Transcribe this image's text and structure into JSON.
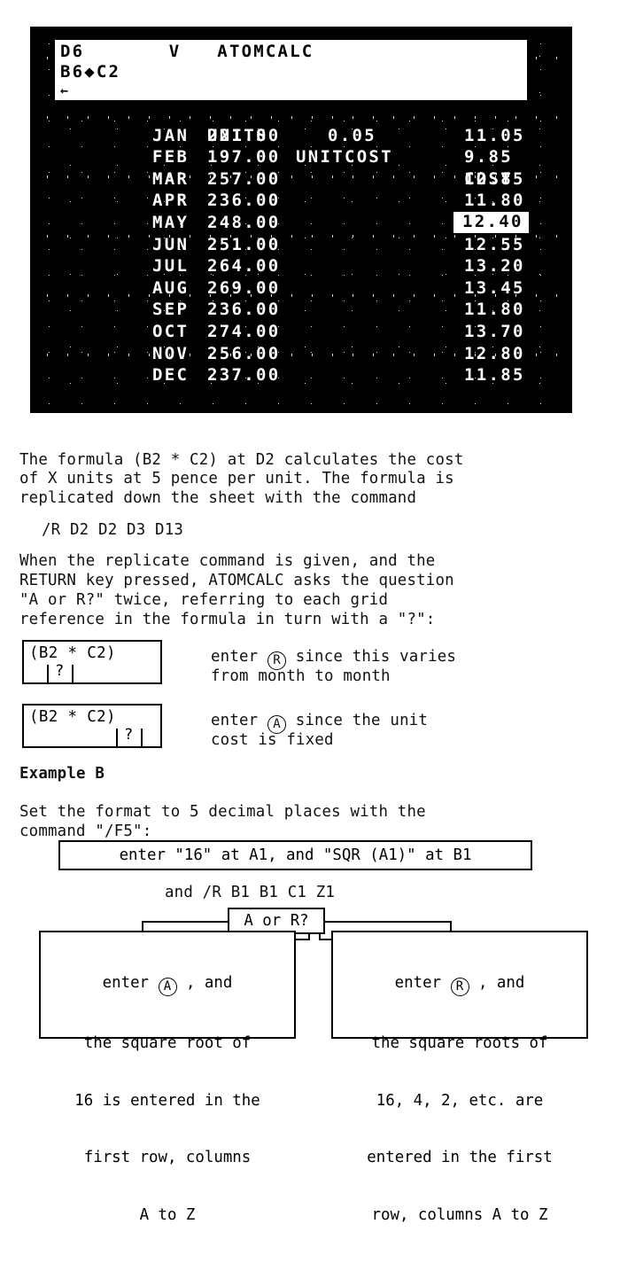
{
  "screen": {
    "status_line1": "D6       V   ATOMCALC",
    "status_line2": "B6◆C2",
    "status_line3": "←",
    "header": {
      "label": "",
      "units": "UNITS",
      "unitcost": "UNITCOST",
      "cost": "COST"
    },
    "rows": [
      {
        "label": "JAN",
        "units": "221.00",
        "unitcost": "0.05",
        "cost": "11.05",
        "highlight": false
      },
      {
        "label": "FEB",
        "units": "197.00",
        "unitcost": "",
        "cost": "9.85",
        "highlight": false
      },
      {
        "label": "MAR",
        "units": "257.00",
        "unitcost": "",
        "cost": "12.85",
        "highlight": false
      },
      {
        "label": "APR",
        "units": "236.00",
        "unitcost": "",
        "cost": "11.80",
        "highlight": false
      },
      {
        "label": "MAY",
        "units": "248.00",
        "unitcost": "",
        "cost": "12.40",
        "highlight": true
      },
      {
        "label": "JUN",
        "units": "251.00",
        "unitcost": "",
        "cost": "12.55",
        "highlight": false
      },
      {
        "label": "JUL",
        "units": "264.00",
        "unitcost": "",
        "cost": "13.20",
        "highlight": false
      },
      {
        "label": "AUG",
        "units": "269.00",
        "unitcost": "",
        "cost": "13.45",
        "highlight": false
      },
      {
        "label": "SEP",
        "units": "236.00",
        "unitcost": "",
        "cost": "11.80",
        "highlight": false
      },
      {
        "label": "OCT",
        "units": "274.00",
        "unitcost": "",
        "cost": "13.70",
        "highlight": false
      },
      {
        "label": "NOV",
        "units": "256.00",
        "unitcost": "",
        "cost": "12.80",
        "highlight": false
      },
      {
        "label": "DEC",
        "units": "237.00",
        "unitcost": "",
        "cost": "11.85",
        "highlight": false
      }
    ]
  },
  "body": {
    "para1_line1": "The formula (B2 * C2) at D2 calculates the cost",
    "para1_line2": "of X units at 5 pence per unit. The formula is",
    "para1_line3": "replicated down the sheet with the command",
    "command1": "/R D2 D2 D3 D13",
    "para2_line1": "When the replicate command is given, and the",
    "para2_line2": "RETURN key pressed, ATOMCALC asks the question",
    "para2_line3": "\"A or R?\" twice, referring to each grid",
    "para2_line4": "reference in the formula in turn with a \"?\":",
    "fbox1_formula": "(B2 * C2)",
    "fbox1_marker": "?",
    "fbox1_note_line1_pre": "enter ",
    "fbox1_note_circle": "R",
    "fbox1_note_line1_post": " since this varies",
    "fbox1_note_line2": "from month to month",
    "fbox2_formula": "(B2 * C2)",
    "fbox2_marker": "?",
    "fbox2_note_line1_pre": "enter ",
    "fbox2_note_circle": "A",
    "fbox2_note_line1_post": " since the unit",
    "fbox2_note_line2": "cost is fixed",
    "example_heading": "Example B",
    "para3_line1": "Set the format to 5 decimal places with the",
    "para3_line2": "command \"/F5\":",
    "obox_top": "enter \"16\" at A1, and \"SQR (A1)\" at B1",
    "replicate_cmd": "and /R B1 B1 C1 Z1",
    "decision_box": "A or R?",
    "left_box": {
      "line1_pre": "enter ",
      "circle": "A",
      "line1_post": " , and",
      "line2": "the square root of",
      "line3": "16 is entered in the",
      "line4": "first row, columns",
      "line5": "A to Z"
    },
    "right_box": {
      "line1_pre": "enter ",
      "circle": "R",
      "line1_post": " , and",
      "line2": "the square roots of",
      "line3": "16, 4, 2, etc. are",
      "line4": "entered in the first",
      "line5": "row, columns A to Z"
    }
  },
  "colors": {
    "screen_bg": "#000000",
    "screen_fg": "#ffffff",
    "page_bg": "#ffffff",
    "ink": "#000000"
  }
}
